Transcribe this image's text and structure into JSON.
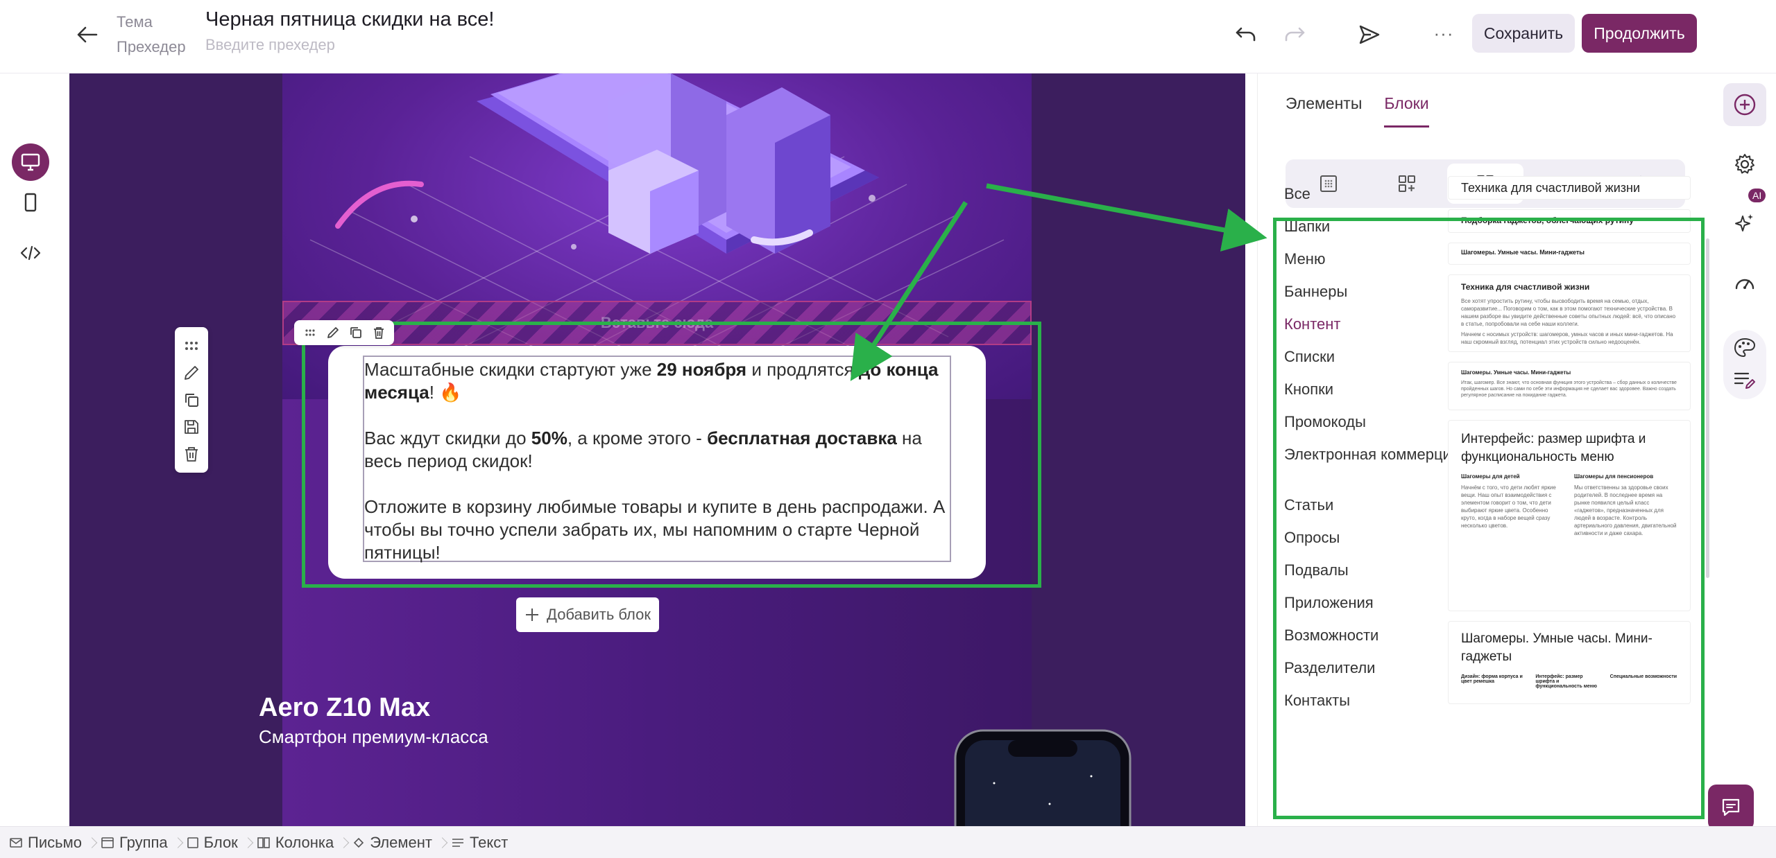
{
  "header": {
    "subject_label": "Тема",
    "preheader_label": "Прехедер",
    "subject_value": "Черная пятница скидки на все!",
    "preheader_placeholder": "Введите прехедер",
    "more_label": "···",
    "save_label": "Сохранить",
    "continue_label": "Продолжить"
  },
  "canvas": {
    "drop_text": "Вставьте сюда",
    "paragraphs": [
      [
        {
          "t": "Масштабные скидки стартуют уже "
        },
        {
          "t": "29 ноября",
          "b": true
        },
        {
          "t": " и продлятся "
        },
        {
          "t": "до конца месяца",
          "b": true
        },
        {
          "t": "! 🔥"
        }
      ],
      [
        {
          "t": "Вас ждут скидки до "
        },
        {
          "t": "50%",
          "b": true
        },
        {
          "t": ", а кроме этого - "
        },
        {
          "t": "бесплатная доставка",
          "b": true
        },
        {
          "t": " на весь период скидок!"
        }
      ],
      [
        {
          "t": "Отложите в корзину любимые товары и купите в день распродажи. А чтобы вы точно успели забрать их, мы напомним о старте Черной пятницы!"
        }
      ]
    ],
    "add_block_label": "Добавить блок",
    "product_title": "Aero Z10 Max",
    "product_subtitle": "Смартфон премиум-класса"
  },
  "panel": {
    "tabs": [
      {
        "label": "Элементы",
        "active": false
      },
      {
        "label": "Блоки",
        "active": true
      }
    ],
    "categories": [
      {
        "label": "Все",
        "active": false
      },
      {
        "label": "Шапки",
        "active": false
      },
      {
        "label": "Меню",
        "active": false
      },
      {
        "label": "Баннеры",
        "active": false
      },
      {
        "label": "Контент",
        "active": true
      },
      {
        "label": "Списки",
        "active": false
      },
      {
        "label": "Кнопки",
        "active": false
      },
      {
        "label": "Промокоды",
        "active": false
      },
      {
        "label": "Электронная коммерция",
        "active": false
      },
      {
        "label": "Статьи",
        "active": false
      },
      {
        "label": "Опросы",
        "active": false
      },
      {
        "label": "Подвалы",
        "active": false
      },
      {
        "label": "Приложения",
        "active": false
      },
      {
        "label": "Возможности",
        "active": false
      },
      {
        "label": "Разделители",
        "active": false
      },
      {
        "label": "Контакты",
        "active": false
      }
    ],
    "thumbs": {
      "t1_title": "Техника для счастливой жизни",
      "t2_title": "Подборка гаджетов, облегчающих рутину",
      "t3_title": "Шагомеры. Умные часы. Мини-гаджеты",
      "t4_title": "Техника для счастливой жизни",
      "t4_body": "Все хотят упростить рутину, чтобы высвободить время на семью, отдых, саморазвитие... Поговорим о том, как в этом помогают технические устройства. В нашем разборе вы увидите действенные советы опытных людей: всё, что описано в статье, попробовали на себе наши коллеги.",
      "t4_body2": "Начнем с носимых устройств: шагомеров, умных часов и иных мини-гаджетов. На наш скромный взгляд, потенциал этих устройств сильно недооценён.",
      "t5_title": "Шагомеры. Умные часы. Мини-гаджеты",
      "t5_body": "Итак, шагомер. Все знают, что основная функция этого устройства – сбор данных о количестве пройденных шагов. Но сами по себе эти информация не сделает вас здоровее. Важно создать регулярное расписание на покидание гаджета.",
      "t6_title": "Интерфейс: размер шрифта и функциональность меню",
      "t6_col1_title": "Шагомеры для детей",
      "t6_col1_body": "Начнём с того, что дети любят яркие вещи. Наш опыт взаимодействия с элементом говорит о том, что дети выбирают яркие цвета. Особенно круто, когда в наборе вещей сразу несколько цветов.",
      "t6_col2_title": "Шагомеры для пенсионеров",
      "t6_col2_body": "Мы ответственны за здоровье своих родителей. В последнее время на рынке появился целый класс «гаджетов», предназначенных для людей в возрасте. Контроль артериального давления, двигательной активности и даже сахара.",
      "t7_title": "Шагомеры. Умные часы. Мини-гаджеты",
      "t7_c1": "Дизайн: форма корпуса и цвет ремешка",
      "t7_c2": "Интерфейс: размер шрифта и функциональность меню",
      "t7_c3": "Специальные возможности"
    }
  },
  "breadcrumbs": [
    {
      "label": "Письмо",
      "icon": "mail-icon"
    },
    {
      "label": "Группа",
      "icon": "group-icon"
    },
    {
      "label": "Блок",
      "icon": "block-icon"
    },
    {
      "label": "Колонка",
      "icon": "column-icon"
    },
    {
      "label": "Элемент",
      "icon": "element-icon"
    },
    {
      "label": "Текст",
      "icon": "text-icon"
    }
  ],
  "right_rail": {
    "ai_badge": "AI"
  },
  "colors": {
    "brand": "#7a2865",
    "highlight": "#2ab04a",
    "canvas_bg": "#3c1e5e"
  }
}
